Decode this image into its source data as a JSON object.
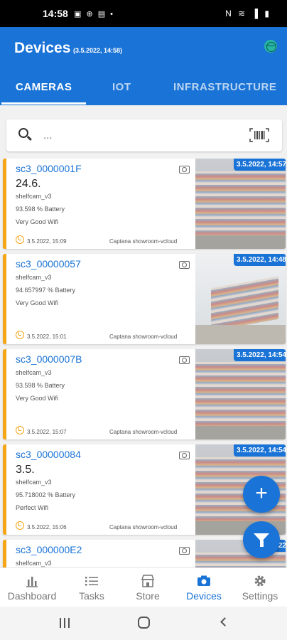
{
  "statusbar": {
    "time": "14:58",
    "left_icons": "▣ ⊕ ▤ •",
    "right_icons": "N ≋ ▐ ▮"
  },
  "header": {
    "title": "Devices",
    "subtitle": "(3.5.2022, 14:58)",
    "globe_icon": "globe-icon"
  },
  "tabs": [
    {
      "label": "CAMERAS",
      "active": true
    },
    {
      "label": "IOT",
      "active": false
    },
    {
      "label": "INFRASTRUCTURE",
      "active": false
    }
  ],
  "search": {
    "placeholder": "...",
    "value": ""
  },
  "devices": [
    {
      "name": "sc3_0000001F",
      "date": "24.6.",
      "model": "shelfcam_v3",
      "battery": "93.598 % Battery",
      "wifi": "Very Good Wifi",
      "timestamp": "3.5.2022, 15:09",
      "location": "Captana showroom-vcloud",
      "badge": "3.5.2022, 14:57"
    },
    {
      "name": "sc3_00000057",
      "date": "",
      "model": "shelfcam_v3",
      "battery": "94.657997 % Battery",
      "wifi": "Very Good Wifi",
      "timestamp": "3.5.2022, 15:01",
      "location": "Captana showroom-vcloud",
      "badge": "3.5.2022, 14:48"
    },
    {
      "name": "sc3_0000007B",
      "date": "",
      "model": "shelfcam_v3",
      "battery": "93.598 % Battery",
      "wifi": "Very Good Wifi",
      "timestamp": "3.5.2022, 15:07",
      "location": "Captana showroom-vcloud",
      "badge": "3.5.2022, 14:54"
    },
    {
      "name": "sc3_00000084",
      "date": "3.5.",
      "model": "shelfcam_v3",
      "battery": "95.718002 % Battery",
      "wifi": "Perfect Wifi",
      "timestamp": "3.5.2022, 15:06",
      "location": "Captana showroom-vcloud",
      "badge": "3.5.2022, 14:54"
    },
    {
      "name": "sc3_000000E2",
      "date": "",
      "model": "shelfcam_v3",
      "battery": "",
      "wifi": "",
      "timestamp": "",
      "location": "",
      "badge": "20.4.2022"
    }
  ],
  "bottomnav": [
    {
      "label": "Dashboard",
      "icon": "dashboard-icon",
      "active": false
    },
    {
      "label": "Tasks",
      "icon": "tasks-icon",
      "active": false
    },
    {
      "label": "Store",
      "icon": "store-icon",
      "active": false
    },
    {
      "label": "Devices",
      "icon": "camera-icon",
      "active": true
    },
    {
      "label": "Settings",
      "icon": "gear-icon",
      "active": false
    }
  ],
  "colors": {
    "primary": "#1a73d6",
    "accent": "#f4a616"
  }
}
